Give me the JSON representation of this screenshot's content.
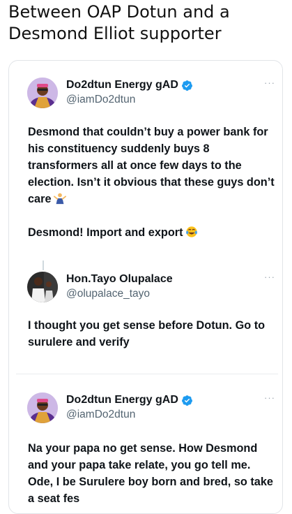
{
  "headline": {
    "line1": "Between OAP Dotun and a",
    "line2": "Desmond Elliot supporter"
  },
  "tweets": [
    {
      "name": "Do2dtun Energy gAD",
      "handle": "@iamDo2dtun",
      "verified": true,
      "more": "···",
      "paragraph1": "Desmond that couldn’t buy a power bank for his constituency suddenly buys 8 transformers all at once few days to the election. Isn’t it obvious that these guys don’t care",
      "paragraph1_emoji": "person-shrugging-emoji",
      "paragraph2": "Desmond! Import and export",
      "paragraph2_emoji": "laughing-tears-emoji"
    },
    {
      "name": "Hon.Tayo Olupalace",
      "handle": "@olupalace_tayo",
      "verified": false,
      "more": "···",
      "paragraph1": "I thought you get sense before Dotun. Go to surulere  and verify"
    },
    {
      "name": "Do2dtun Energy gAD",
      "handle": "@iamDo2dtun",
      "verified": true,
      "more": "···",
      "paragraph1": "Na your papa no get sense. How Desmond and your papa take relate, you go tell me. Ode, I be Surulere boy born and bred, so take a seat fes"
    }
  ],
  "colors": {
    "text": "#0f1419",
    "handle": "#536471",
    "verified": "#1d9bf0",
    "border": "#e1e4e8"
  }
}
